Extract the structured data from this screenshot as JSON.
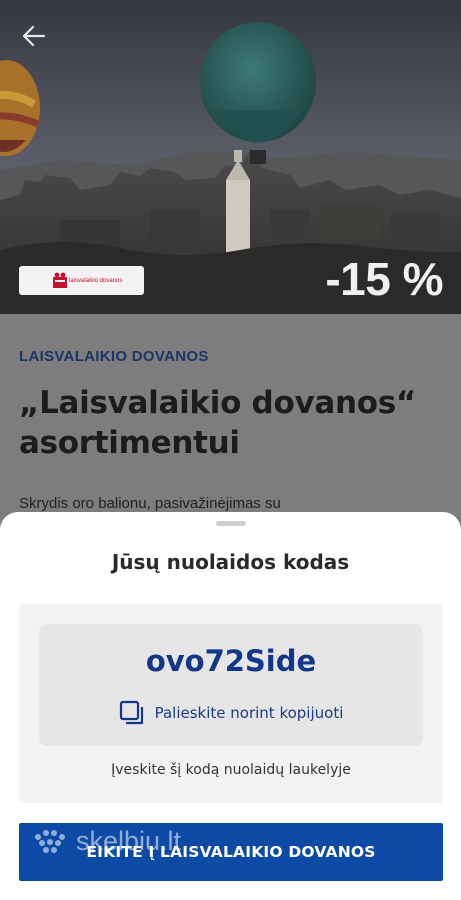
{
  "hero": {
    "discount_badge": "-15 %",
    "partner_logo_text": "laisvalaikio dovanos"
  },
  "article": {
    "category": "LAISVALAIKIO DOVANOS",
    "title": "„Laisvalaikio dovanos“ asortimentui",
    "body_preview": "Skrydis oro balionu, pasivažinėjimas su"
  },
  "sheet": {
    "title": "Jūsų nuolaidos kodas",
    "code": "ovo72Side",
    "copy_label": "Palieskite norint kopijuoti",
    "hint": "Įveskite šį kodą nuolaidų laukelyje",
    "cta_label": "EIKITE Į LAISVALAIKIO DOVANOS"
  },
  "icons": {
    "back": "arrow-left-icon",
    "copy": "copy-icon"
  },
  "colors": {
    "brand_blue": "#0c4aa6",
    "code_blue": "#12368a",
    "partner_red": "#c8102e"
  },
  "watermark": {
    "text": "skelbiu.lt"
  }
}
